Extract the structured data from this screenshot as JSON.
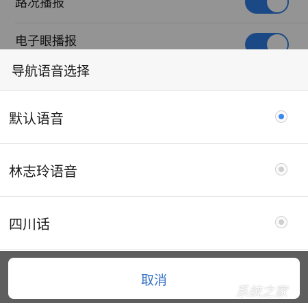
{
  "background": {
    "rows": [
      {
        "label": "路况播报",
        "toggle_on": true
      },
      {
        "label": "电子眼播报",
        "toggle_on": true
      }
    ]
  },
  "sheet": {
    "title": "导航语音选择",
    "options": [
      {
        "label": "默认语音",
        "selected": true
      },
      {
        "label": "林志玲语音",
        "selected": false
      },
      {
        "label": "四川话",
        "selected": false
      }
    ],
    "cancel_label": "取消"
  },
  "watermark": {
    "text": "系统之家"
  },
  "colors": {
    "accent": "#3a87f0",
    "toggle": "#2f7fe6",
    "cancel_text": "#3270c8"
  }
}
